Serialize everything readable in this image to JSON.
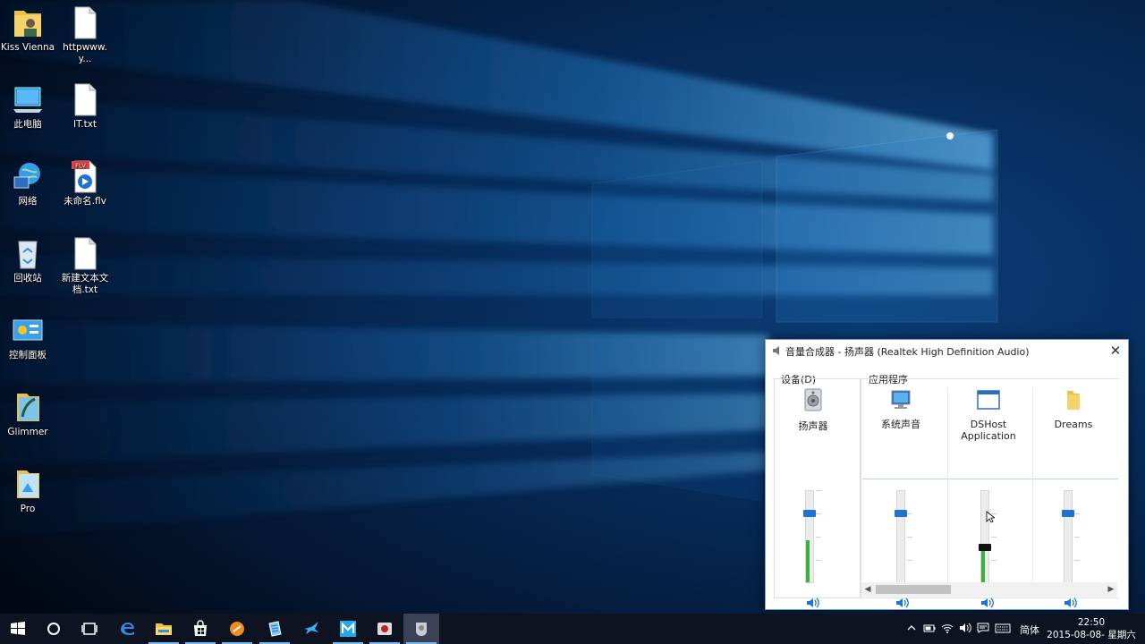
{
  "desktop": {
    "icons": [
      {
        "label": "Kiss Vienna"
      },
      {
        "label": "httpwww.y..."
      },
      {
        "label": "此电脑"
      },
      {
        "label": "IT.txt"
      },
      {
        "label": "网络"
      },
      {
        "label": "未命名.flv",
        "badge": "FLV"
      },
      {
        "label": "回收站"
      },
      {
        "label": "新建文本文档.txt"
      },
      {
        "label": "控制面板"
      },
      {
        "label": "Glimmer"
      },
      {
        "label": "Pro"
      }
    ]
  },
  "mixer": {
    "title": "音量合成器 - 扬声器 (Realtek High Definition Audio)",
    "close_label": "✕",
    "device_group": "设备(D)",
    "apps_group": "应用程序",
    "device": {
      "name": "扬声器",
      "level": 0.75,
      "meter": 0.45,
      "icon": "speaker-device-icon"
    },
    "apps": [
      {
        "name": "系统声音",
        "level": 0.75,
        "meter": 0,
        "icon": "monitor-speaker-icon"
      },
      {
        "name": "DSHost",
        "name2": "Application",
        "level": 0.38,
        "meter": 0.38,
        "icon": "app-window-icon"
      },
      {
        "name": "Dreams",
        "level": 0.75,
        "meter": 0,
        "icon": "folder-icon"
      }
    ]
  },
  "taskbar": {
    "items": [
      "start-icon",
      "cortana-icon",
      "task-view-icon",
      "edge-icon",
      "file-explorer-icon",
      "store-icon",
      "orange-app-icon",
      "notepad-app-icon",
      "bird-app-icon",
      "m-app-icon",
      "media-app-icon",
      "volume-mixer-app-icon"
    ],
    "ime": "简体",
    "time": "22:50",
    "date": "2015-08-08- 星期六"
  },
  "colors": {
    "accent": "#1e73d2",
    "meter": "#38b43a",
    "taskbar": "#0d1320"
  }
}
